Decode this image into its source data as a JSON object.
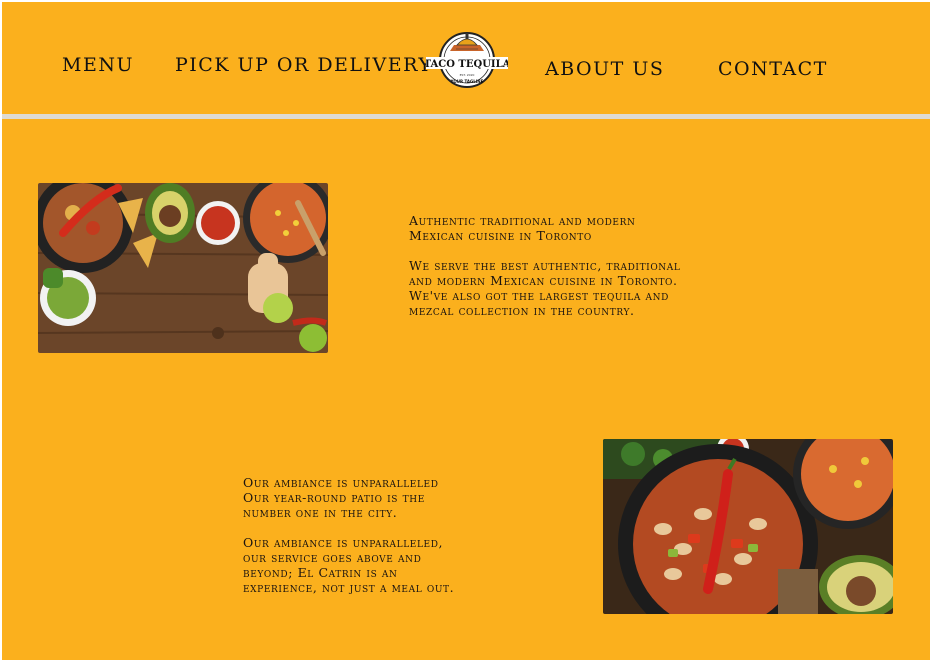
{
  "nav": {
    "menu": "MENU",
    "pickup": "PICK UP OR DELIVERY",
    "about": "ABOUT US",
    "contact": "CONTACT"
  },
  "logo": {
    "name": "TACO TEQUILA",
    "tagline": "YOUR TAGLINE",
    "est": "EST. 2020"
  },
  "section1": {
    "heading_line1": "Authentic traditional and modern",
    "heading_line2": "Mexican cuisine in Toronto",
    "body_line1": "We serve the best authentic, traditional",
    "body_line2": "and modern Mexican cuisine in Toronto.",
    "body_line3": "We've also got the largest tequila and",
    "body_line4": "mezcal collection in the country."
  },
  "section2": {
    "heading_line1": "Our ambiance is unparalleled",
    "heading_line2": "Our year-round patio is the",
    "heading_line3": "number one in the city.",
    "body_line1": "Our ambiance is unparalleled,",
    "body_line2": "our service goes above and",
    "body_line3": "beyond; El Catrin is an",
    "body_line4": "experience, not just a meal out."
  },
  "colors": {
    "background": "#fbb01d",
    "text": "#111111",
    "divider": "#dedad2"
  }
}
